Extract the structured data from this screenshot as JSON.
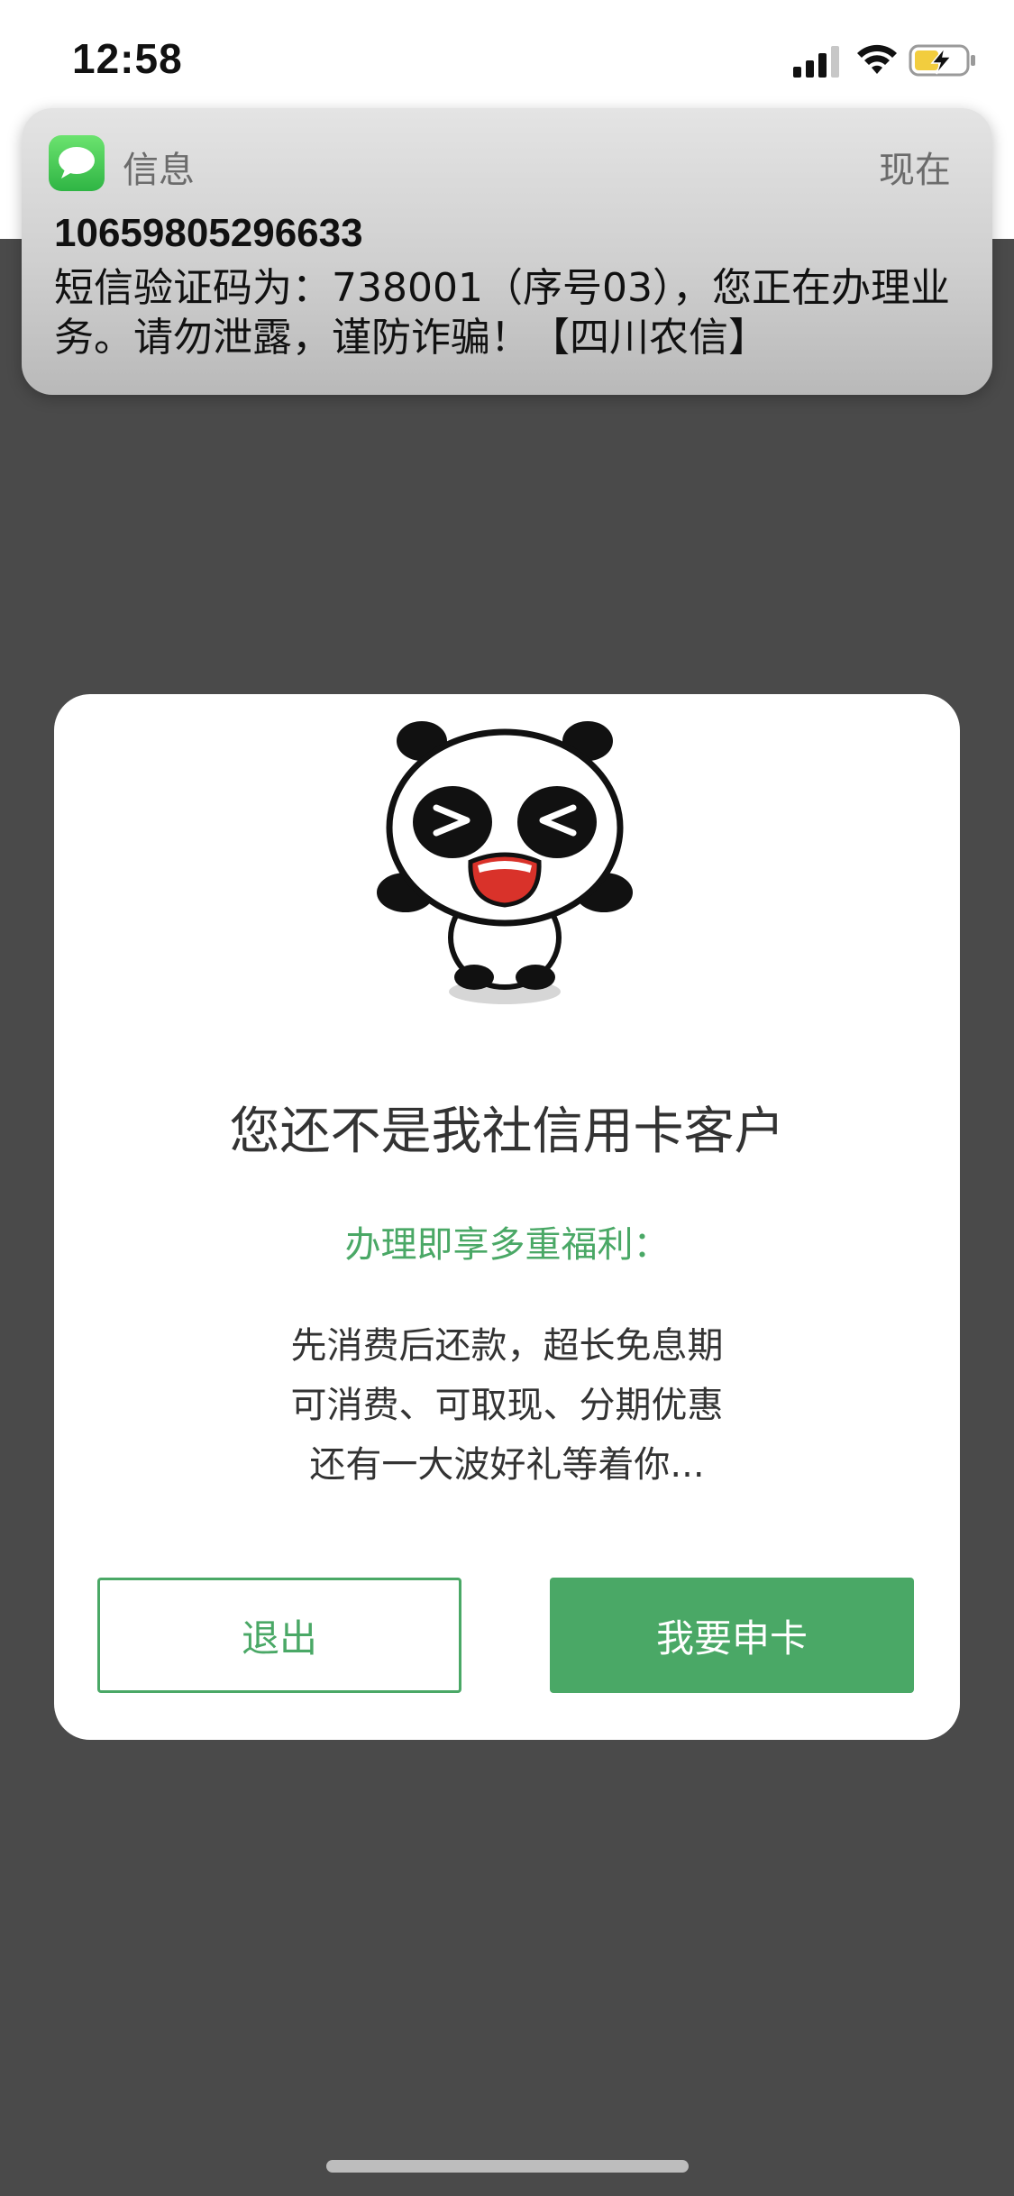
{
  "status_bar": {
    "time": "12:58"
  },
  "notification": {
    "app_name": "信息",
    "time": "现在",
    "sender": "10659805296633",
    "body": "短信验证码为：738001（序号03），您正在办理业务。请勿泄露，谨防诈骗！【四川农信】"
  },
  "dialog": {
    "title": "您还不是我社信用卡客户",
    "subtitle": "办理即享多重福利：",
    "desc_lines": [
      "先消费后还款，超长免息期",
      "可消费、可取现、分期优惠",
      "还有一大波好礼等着你..."
    ],
    "exit_label": "退出",
    "apply_label": "我要申卡"
  },
  "colors": {
    "accent_green": "#4aa866",
    "overlay": "#4a4a4a"
  },
  "icons": {
    "status": [
      "signal-icon",
      "wifi-icon",
      "battery-charging-icon"
    ],
    "notification": "messages-app-icon",
    "dialog": "panda-mascot-icon"
  }
}
